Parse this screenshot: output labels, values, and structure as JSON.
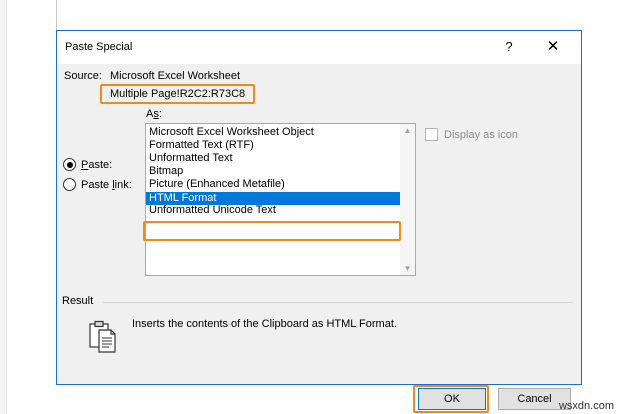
{
  "dialog": {
    "title": "Paste Special",
    "help_glyph": "?",
    "close_glyph": "✕"
  },
  "source": {
    "label": "Source:",
    "value": "Microsoft Excel Worksheet",
    "range": "Multiple Page!R2C2:R73C8"
  },
  "as_label_prefix": "A",
  "as_label_underlined": "s",
  "as_label_suffix": ":",
  "radios": [
    {
      "pre": "",
      "ul": "P",
      "post": "aste:",
      "checked": true
    },
    {
      "pre": "Paste ",
      "ul": "l",
      "post": "ink:",
      "checked": false
    }
  ],
  "list_items": [
    "Microsoft Excel Worksheet Object",
    "Formatted Text (RTF)",
    "Unformatted Text",
    "Bitmap",
    "Picture (Enhanced Metafile)",
    "HTML Format",
    "Unformatted Unicode Text"
  ],
  "selected_index": 5,
  "display_as_icon": "Display as icon",
  "result": {
    "label": "Result",
    "text": "Inserts the contents of the Clipboard as HTML Format."
  },
  "buttons": {
    "ok": "OK",
    "cancel": "Cancel"
  },
  "watermark": "wsxdn.com",
  "colors": {
    "highlight_outline": "#f28a1a",
    "selection": "#0078d7"
  }
}
